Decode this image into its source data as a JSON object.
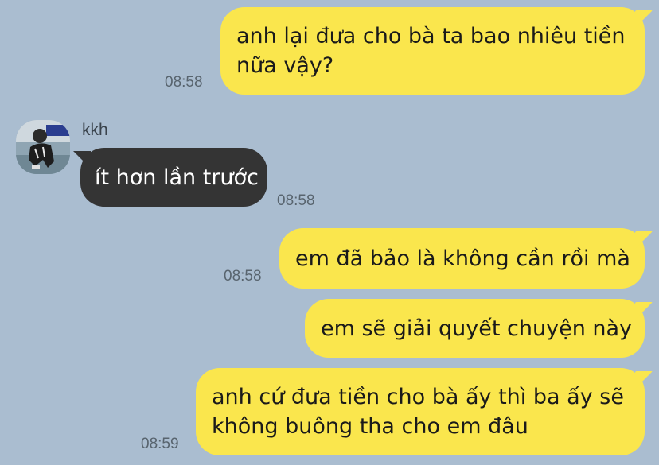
{
  "colors": {
    "background": "#aabdd0",
    "outgoing_bubble": "#fae64d",
    "incoming_bubble": "#343434",
    "timestamp": "#58646e"
  },
  "contact": {
    "name": "kkh",
    "avatar": "avatar-photo"
  },
  "messages": [
    {
      "direction": "outgoing",
      "lines": [
        "anh lại đưa cho bà ta bao nhiêu tiền",
        "nữa vậy?"
      ],
      "time": "08:58"
    },
    {
      "direction": "incoming",
      "lines": [
        "ít hơn lần trước"
      ],
      "time": "08:58"
    },
    {
      "direction": "outgoing",
      "lines": [
        "em đã bảo là không cần rồi mà"
      ],
      "time": "08:58"
    },
    {
      "direction": "outgoing",
      "lines": [
        "em sẽ giải quyết chuyện này"
      ],
      "time": ""
    },
    {
      "direction": "outgoing",
      "lines": [
        "anh cứ đưa tiền cho bà ấy thì ba ấy sẽ",
        "không buông tha cho em đâu"
      ],
      "time": "08:59"
    }
  ]
}
